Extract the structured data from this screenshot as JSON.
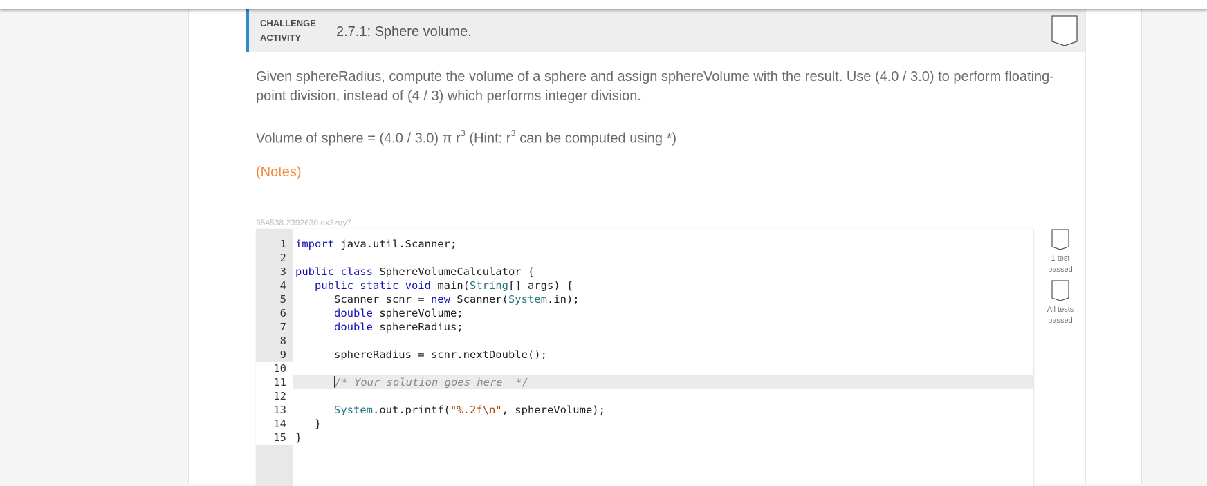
{
  "activity": {
    "type_label": "CHALLENGE ACTIVITY",
    "title": "2.7.1: Sphere volume.",
    "completion_icon": "bookmark-outline-icon"
  },
  "prompt": {
    "text": "Given sphereRadius, compute the volume of a sphere and assign sphereVolume with the result. Use (4.0 / 3.0) to perform floating-point division, instead of (4 / 3) which performs integer division.",
    "formula_before": "Volume of sphere = (4.0 / 3.0) π r",
    "exponent_1": "3",
    "formula_middle": " (Hint: r",
    "exponent_2": "3",
    "formula_after": " can be computed using *)"
  },
  "notes_link": "(Notes)",
  "activity_id": "354538.2392630.qx3zqy7",
  "editor": {
    "line_numbers": [
      "1",
      "2",
      "3",
      "4",
      "5",
      "6",
      "7",
      "8",
      "9",
      "10",
      "11",
      "12",
      "13",
      "14",
      "15"
    ],
    "active_line": 11,
    "code": [
      "import java.util.Scanner;",
      "",
      "public class SphereVolumeCalculator {",
      "   public static void main(String[] args) {",
      "      Scanner scnr = new Scanner(System.in);",
      "      double sphereVolume;",
      "      double sphereRadius;",
      "",
      "      sphereRadius = scnr.nextDouble();",
      "",
      "      /* Your solution goes here  */",
      "",
      "      System.out.printf(\"%.2f\\n\", sphereVolume);",
      "   }",
      "}"
    ]
  },
  "tests": [
    {
      "label": "1 test passed",
      "icon": "test-status-outline-icon",
      "passed": false
    },
    {
      "label": "All tests passed",
      "icon": "test-status-outline-icon",
      "passed": false
    }
  ],
  "colors": {
    "accent_border": "#2b8ccb",
    "notes_link": "#ef8a3c",
    "keyword": "#1414b4",
    "type": "#1f7780",
    "string": "#a3450d"
  }
}
